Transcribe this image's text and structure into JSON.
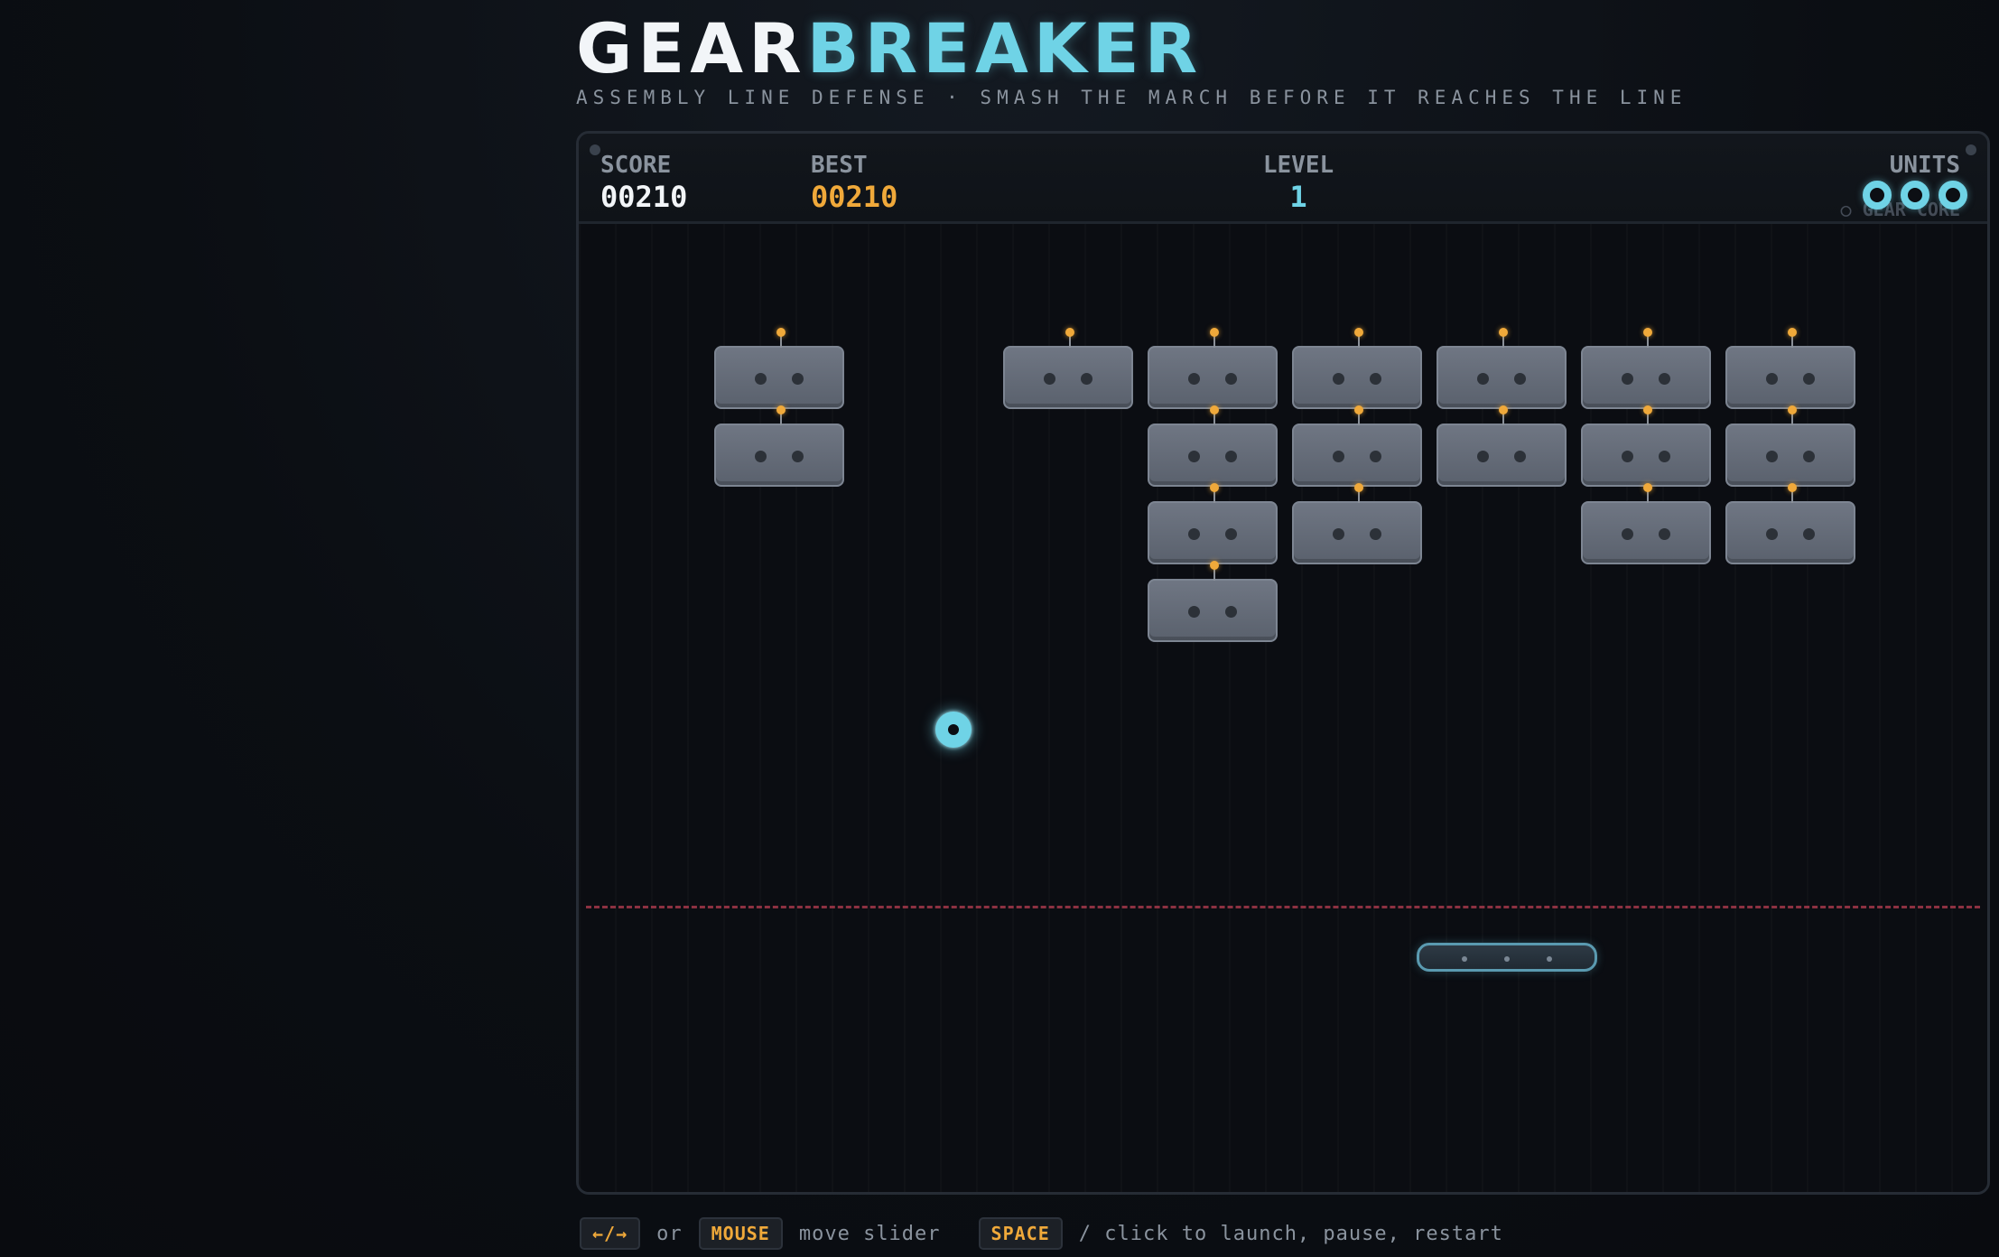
{
  "game": {
    "title_part1": "GEAR",
    "title_part2": "BREAKER",
    "subtitle": "ASSEMBLY LINE DEFENSE · SMASH THE MARCH BEFORE IT REACHES THE LINE"
  },
  "hud": {
    "score_label": "SCORE",
    "score_value": "00210",
    "best_label": "BEST",
    "best_value": "00210",
    "level_label": "LEVEL",
    "level_value": "1",
    "units_label": "UNITS",
    "units_remaining": 3,
    "core_label": "○ GEAR CORE"
  },
  "controls": {
    "key_arrows": "←/→",
    "or_text": "or",
    "key_mouse": "MOUSE",
    "move_text": "move slider",
    "key_space": "SPACE",
    "action_text": "/ click to launch, pause, restart"
  },
  "board": {
    "columns": 8,
    "rows": [
      [
        1,
        0,
        1,
        1,
        1,
        1,
        1,
        1
      ],
      [
        1,
        0,
        0,
        1,
        1,
        1,
        1,
        1
      ],
      [
        0,
        0,
        0,
        1,
        1,
        0,
        1,
        1
      ],
      [
        0,
        0,
        0,
        1,
        0,
        0,
        0,
        0
      ]
    ]
  },
  "colors": {
    "accent": "#6fd3e6",
    "best": "#f0a93a",
    "deadline": "#a3384a",
    "bot": "#6f7683"
  }
}
